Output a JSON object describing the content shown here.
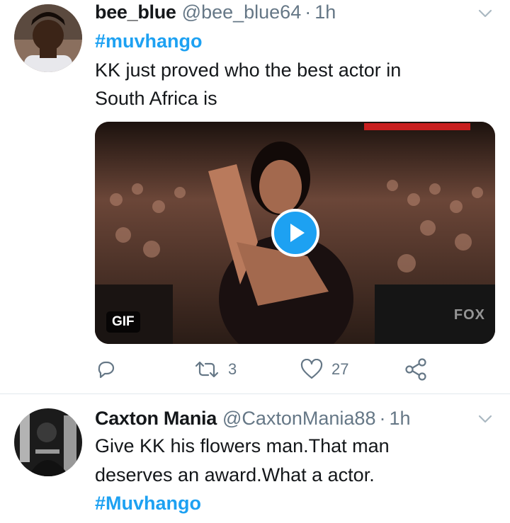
{
  "tweets": [
    {
      "name": "bee_blue",
      "handle": "@bee_blue64",
      "separator": "·",
      "time": "1h",
      "hashtag": "#muvhango",
      "text_lines": [
        "KK just proved who the best actor  in",
        "South Africa is"
      ],
      "media": {
        "badge": "GIF",
        "watermark": "FOX"
      },
      "actions": {
        "retweets": "3",
        "likes": "27"
      }
    },
    {
      "name": "Caxton Mania",
      "handle": "@CaxtonMania88",
      "separator": "·",
      "time": "1h",
      "text_lines": [
        "Give KK his flowers man.That man",
        "deserves an award.What a actor."
      ],
      "hashtag": "#Muvhango"
    }
  ],
  "colors": {
    "link": "#1da1f2",
    "secondary_text": "#657786",
    "divider": "#e1e8ed"
  },
  "icons": [
    "reply-icon",
    "retweet-icon",
    "like-icon",
    "share-icon",
    "chevron-down-icon",
    "play-icon"
  ]
}
